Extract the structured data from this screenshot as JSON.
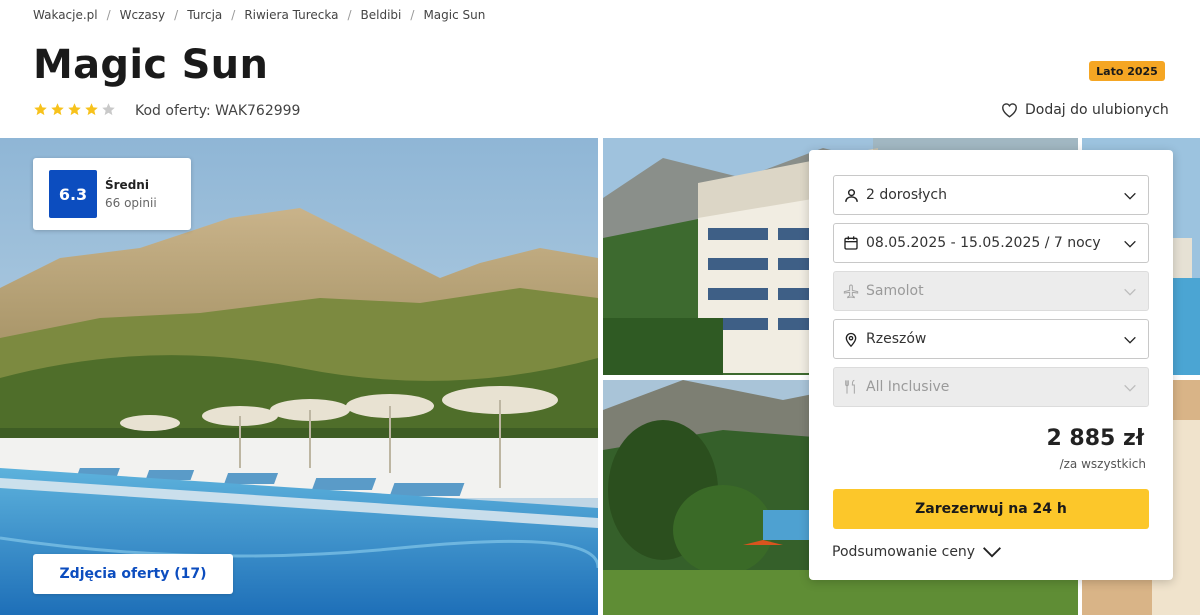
{
  "breadcrumb": [
    "Wakacje.pl",
    "Wczasy",
    "Turcja",
    "Riwiera Turecka",
    "Beldibi",
    "Magic Sun"
  ],
  "hotel": {
    "name": "Magic Sun",
    "stars": 4,
    "stars_max": 5,
    "offer_code": "Kod oferty: WAK762999",
    "season_badge": "Lato 2025"
  },
  "favorite_label": "Dodaj do ulubionych",
  "rating": {
    "score": "6.3",
    "label": "Średni",
    "reviews": "66 opinii"
  },
  "photos_button": "Zdjęcia oferty (17)",
  "booking": {
    "travelers": "2 dorosłych",
    "dates": "08.05.2025 - 15.05.2025 / 7 nocy",
    "transport": "Samolot",
    "departure": "Rzeszów",
    "board": "All Inclusive",
    "price": "2 885 zł",
    "price_note": "/za wszystkich",
    "book_label": "Zarezerwuj na 24 h",
    "summary_label": "Podsumowanie ceny"
  },
  "colors": {
    "brand_blue": "#0c4dbf",
    "cta_yellow": "#fcc72a",
    "badge_orange": "#f5a623",
    "star_yellow": "#f7c21c"
  }
}
